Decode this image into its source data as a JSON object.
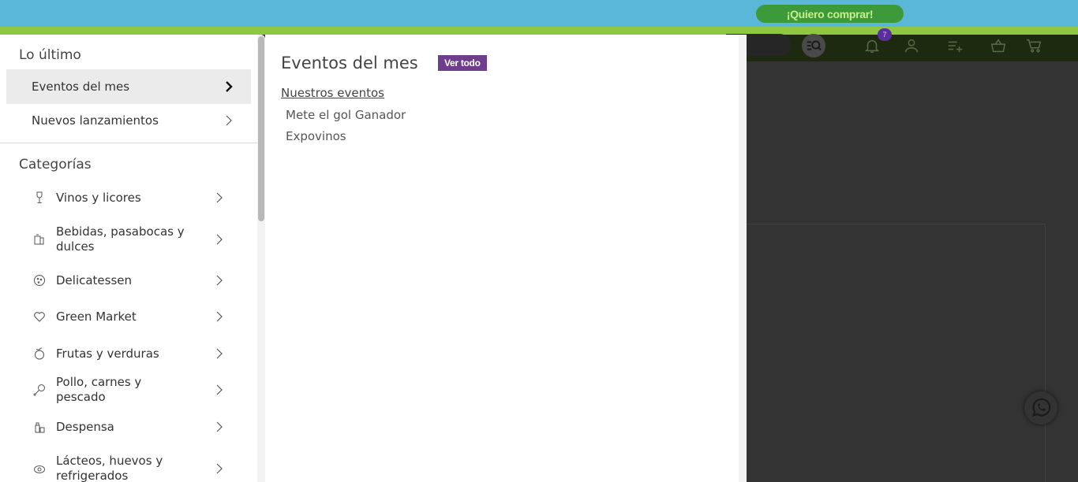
{
  "promo": {
    "cta_label": "¡Quiero comprar!"
  },
  "header": {
    "notification_count": "7"
  },
  "menu": {
    "latest_title": "Lo último",
    "latest_items": [
      {
        "label": "Eventos del mes",
        "active": true
      },
      {
        "label": "Nuevos lanzamientos",
        "active": false
      }
    ],
    "categories_title": "Categorías",
    "categories": [
      {
        "label": "Vinos y licores",
        "icon": "wine-glass-icon"
      },
      {
        "label": "Bebidas, pasabocas y dulces",
        "icon": "snacks-icon"
      },
      {
        "label": "Delicatessen",
        "icon": "cookie-icon"
      },
      {
        "label": "Green Market",
        "icon": "heart-leaf-icon"
      },
      {
        "label": "Frutas y verduras",
        "icon": "fruit-icon"
      },
      {
        "label": "Pollo, carnes y pescado",
        "icon": "drumstick-icon"
      },
      {
        "label": "Despensa",
        "icon": "pantry-icon"
      },
      {
        "label": "Lácteos, huevos y refrigerados",
        "icon": "egg-icon"
      }
    ]
  },
  "submenu": {
    "title": "Eventos del mes",
    "view_all_label": "Ver todo",
    "section_heading": "Nuestros eventos",
    "links": [
      "Mete el gol Ganador",
      "Expovinos"
    ]
  },
  "colors": {
    "promo_bar": "#5bb7d8",
    "promo_strip": "#8fc740",
    "cta_bg": "#3d9a3a",
    "badge": "#5a2e9e",
    "view_all_bg": "#6e3e8c"
  }
}
